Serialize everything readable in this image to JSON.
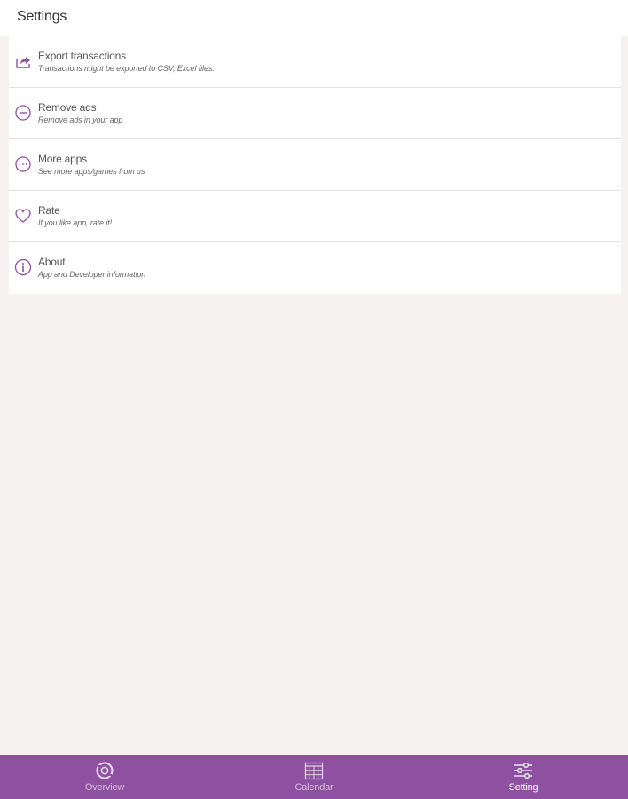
{
  "header": {
    "title": "Settings"
  },
  "settings": {
    "items": [
      {
        "icon": "share-icon",
        "label": "Export transactions",
        "description": "Transactions might be exported to CSV, Excel files."
      },
      {
        "icon": "minus-circle-icon",
        "label": "Remove ads",
        "description": "Remove ads in your app"
      },
      {
        "icon": "more-circle-icon",
        "label": "More apps",
        "description": "See more apps/games from us"
      },
      {
        "icon": "heart-icon",
        "label": "Rate",
        "description": "If you like app, rate it!"
      },
      {
        "icon": "info-circle-icon",
        "label": "About",
        "description": "App and Developer information"
      }
    ]
  },
  "tabbar": {
    "tabs": [
      {
        "icon": "overview-icon",
        "label": "Overview",
        "active": false
      },
      {
        "icon": "calendar-icon",
        "label": "Calendar",
        "active": false
      },
      {
        "icon": "sliders-icon",
        "label": "Setting",
        "active": true
      }
    ]
  },
  "colors": {
    "accent": "#8e51a2",
    "background": "#f6f2f2",
    "icon": "#8e51a2"
  }
}
